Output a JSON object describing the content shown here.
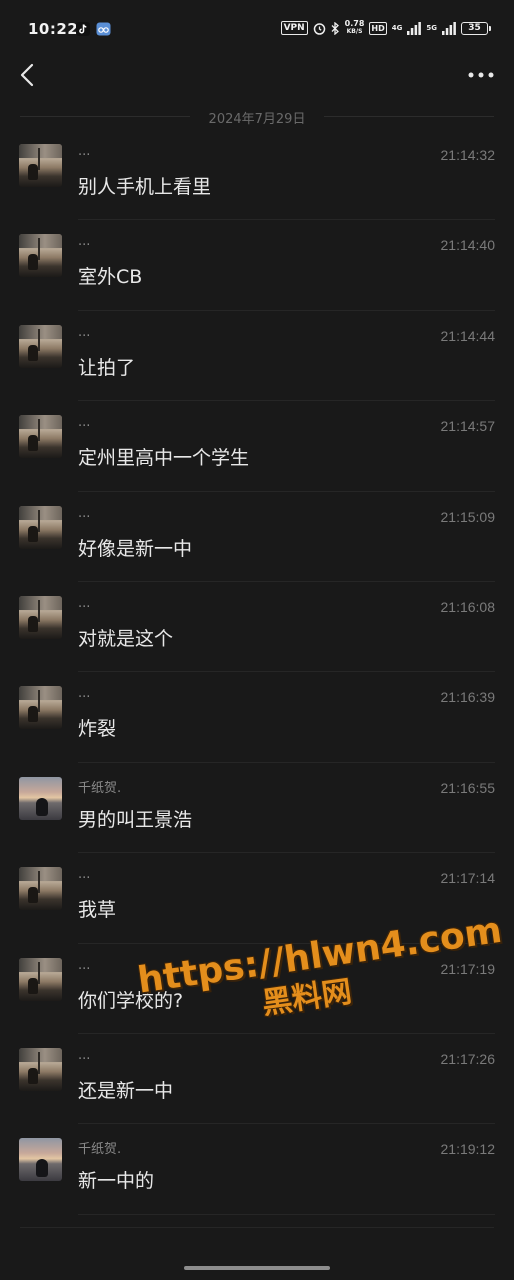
{
  "status_bar": {
    "time": "10:22",
    "vpn": "VPN",
    "net_speed_value": "0.78",
    "net_speed_unit": "KB/S",
    "hd": "HD",
    "net1": "4G",
    "net2": "5G",
    "battery": "35"
  },
  "date_divider": "2024年7月29日",
  "messages": [
    {
      "sender": "...",
      "time": "21:14:32",
      "text": "别人手机上看里",
      "avatar": "sunset"
    },
    {
      "sender": "...",
      "time": "21:14:40",
      "text": "室外CB",
      "avatar": "sunset"
    },
    {
      "sender": "...",
      "time": "21:14:44",
      "text": "让拍了",
      "avatar": "sunset"
    },
    {
      "sender": "...",
      "time": "21:14:57",
      "text": "定州里高中一个学生",
      "avatar": "sunset"
    },
    {
      "sender": "...",
      "time": "21:15:09",
      "text": "好像是新一中",
      "avatar": "sunset"
    },
    {
      "sender": "...",
      "time": "21:16:08",
      "text": "对就是这个",
      "avatar": "sunset"
    },
    {
      "sender": "...",
      "time": "21:16:39",
      "text": "炸裂",
      "avatar": "sunset"
    },
    {
      "sender": "千纸贺.",
      "time": "21:16:55",
      "text": "男的叫王景浩",
      "avatar": "beach"
    },
    {
      "sender": "...",
      "time": "21:17:14",
      "text": "我草",
      "avatar": "sunset"
    },
    {
      "sender": "...",
      "time": "21:17:19",
      "text": "你们学校的?",
      "avatar": "sunset"
    },
    {
      "sender": "...",
      "time": "21:17:26",
      "text": "还是新一中",
      "avatar": "sunset"
    },
    {
      "sender": "千纸贺.",
      "time": "21:19:12",
      "text": "新一中的",
      "avatar": "beach"
    }
  ],
  "watermark": {
    "line1": "https://hlwn4.com",
    "line2": "黑料网",
    "color": "#e48e1c"
  },
  "icons": {
    "back": "back-arrow-icon",
    "more": "more-dots-icon"
  }
}
